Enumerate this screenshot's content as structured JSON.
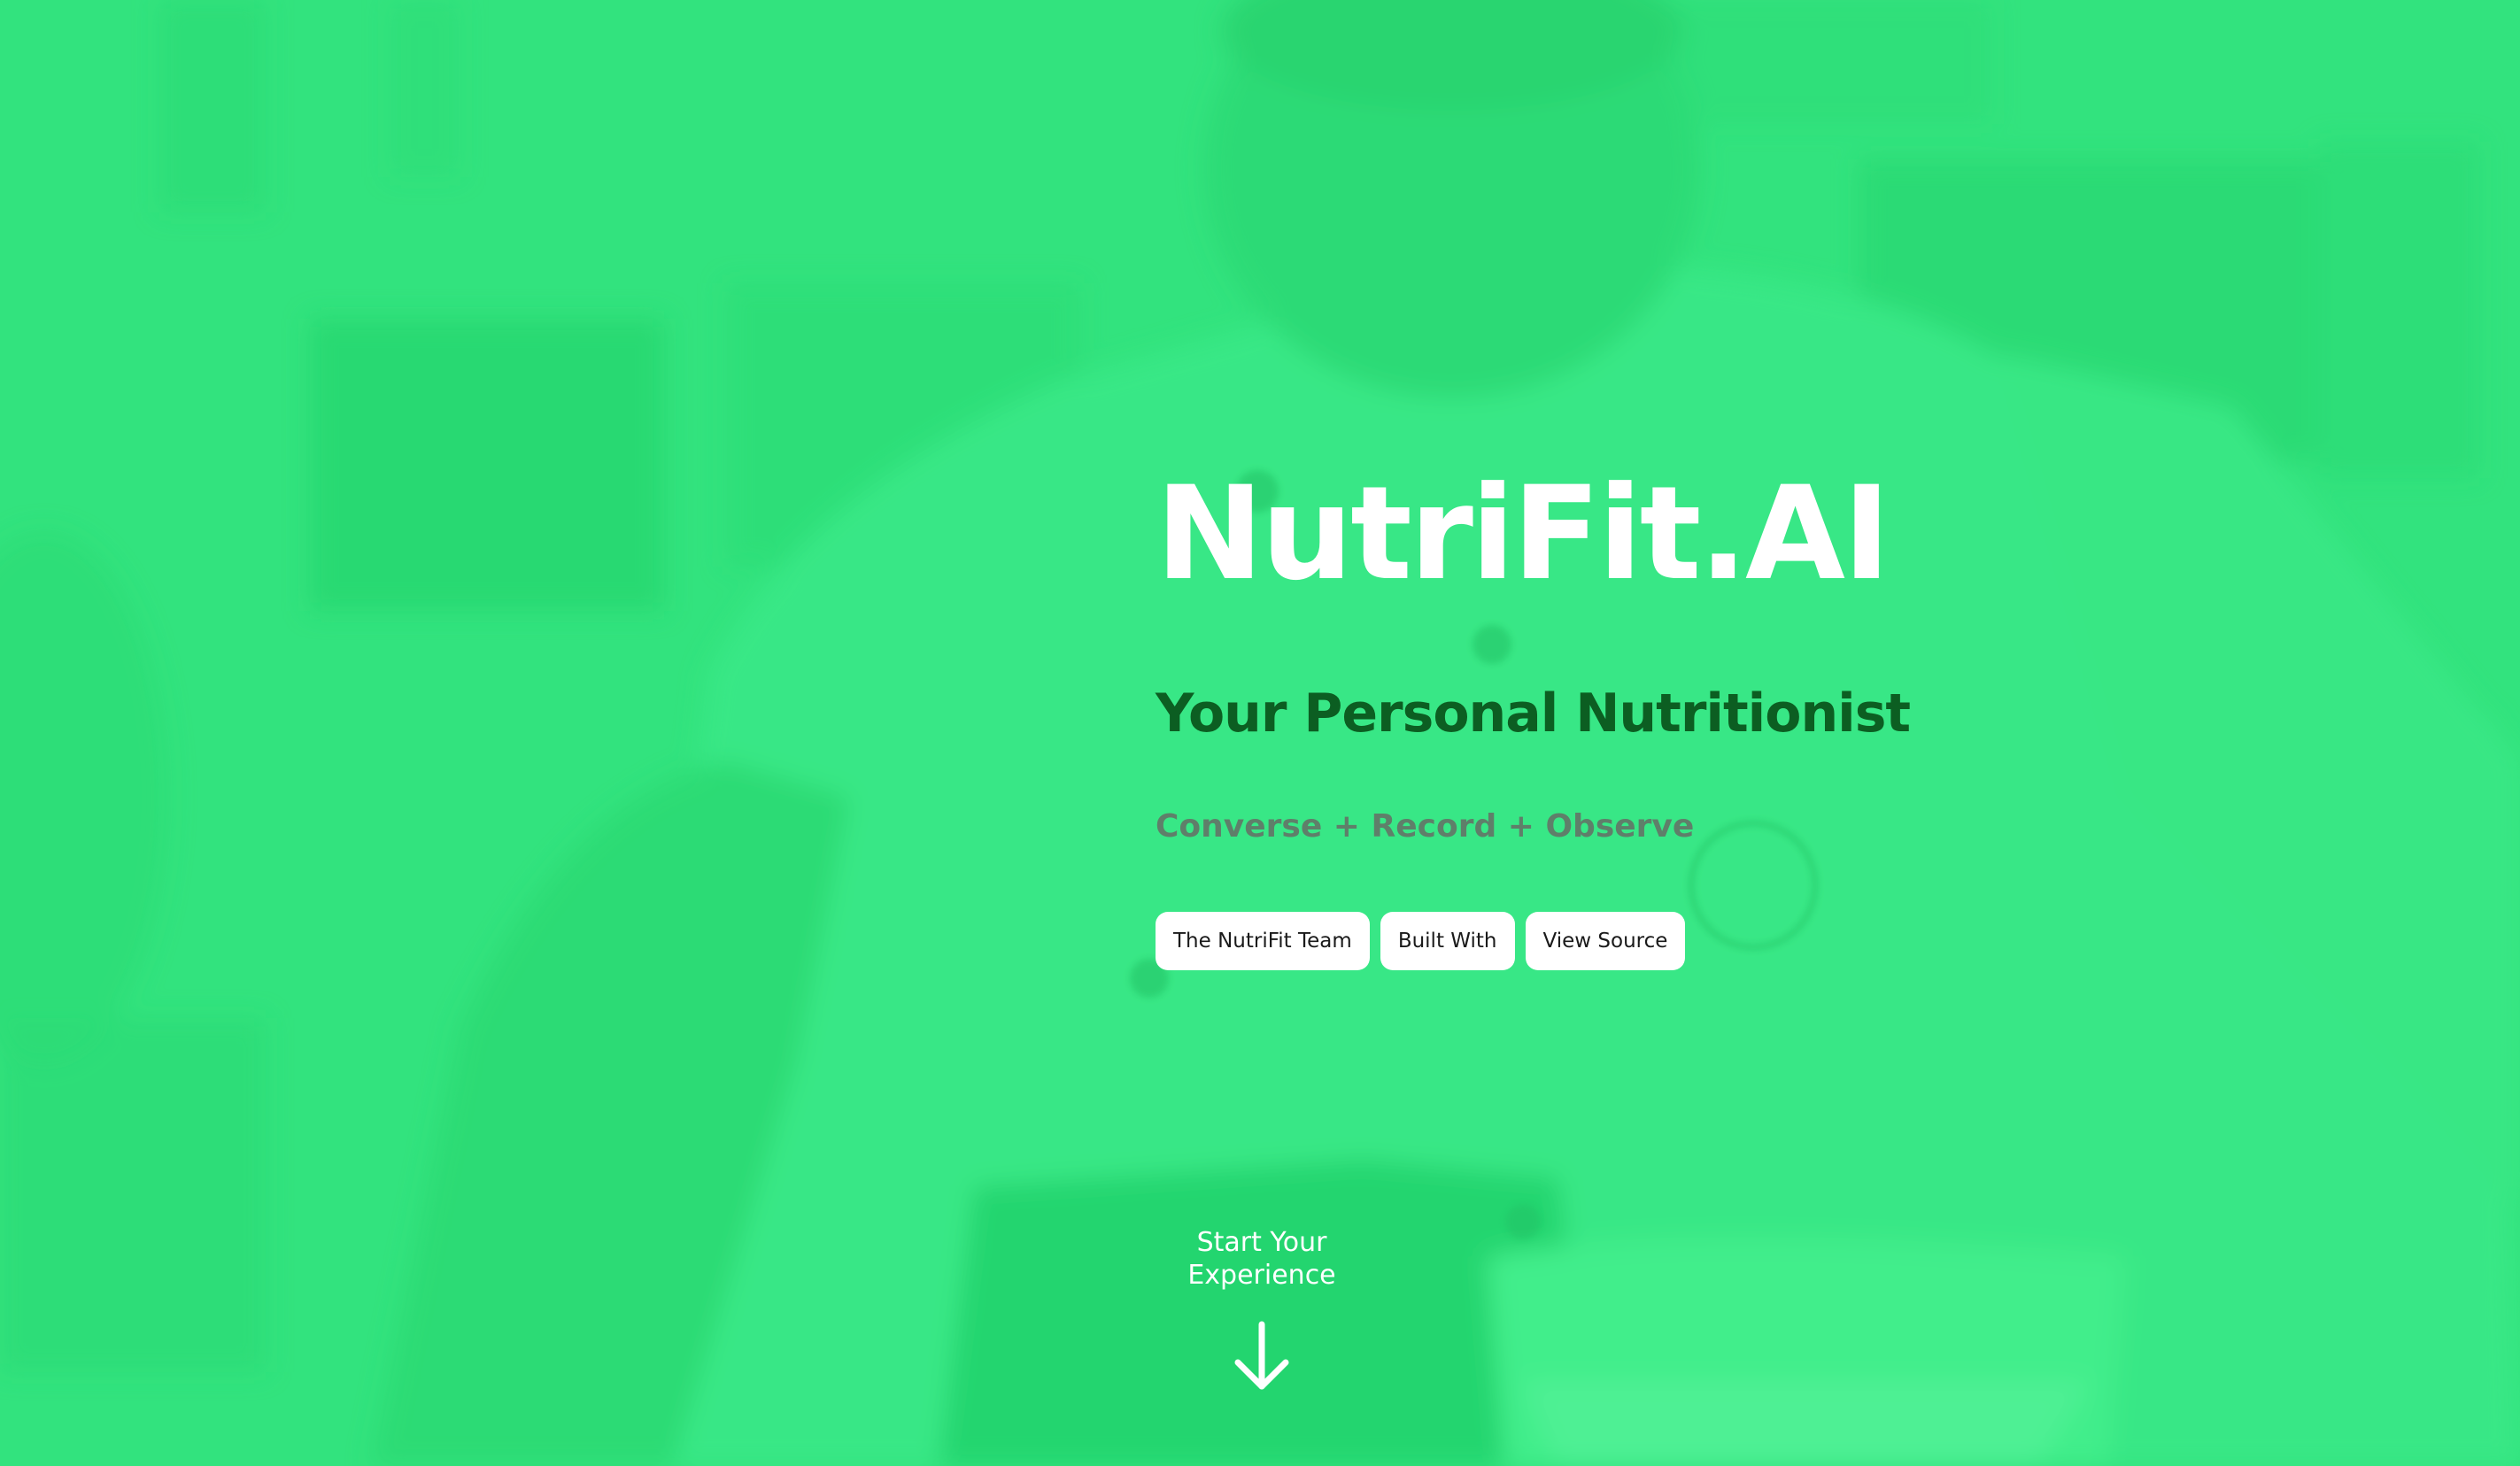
{
  "hero": {
    "title": "NutriFit.AI",
    "tagline": "Your Personal Nutritionist",
    "subtagline": "Converse + Record + Observe"
  },
  "buttons": [
    {
      "label": "The NutriFit Team"
    },
    {
      "label": "Built With"
    },
    {
      "label": "View Source"
    }
  ],
  "cta": {
    "line1": "Start Your",
    "line2": "Experience",
    "icon": "arrow-down-icon"
  },
  "colors": {
    "background_tint": "#32e37d",
    "title": "#ffffff",
    "tagline": "#0c5e22",
    "subtagline": "#5f7f6a",
    "button_bg": "#ffffff",
    "button_text": "#1a1a1a"
  }
}
